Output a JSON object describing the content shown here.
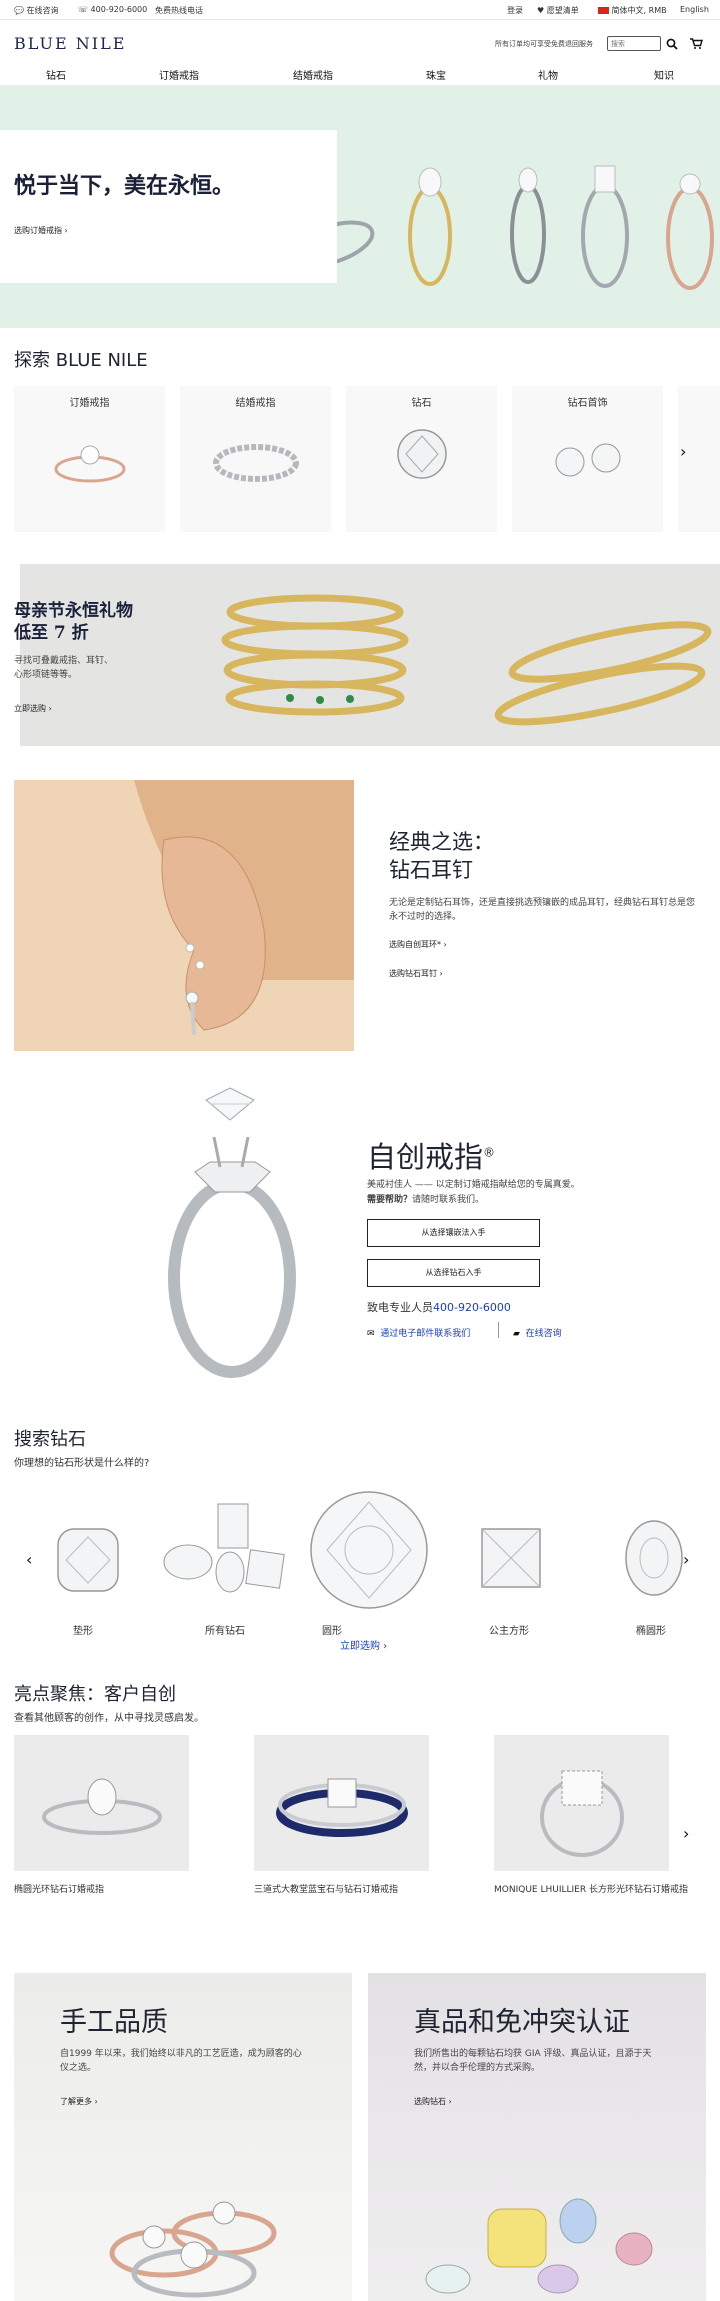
{
  "topbar": {
    "online_chat": "在线咨询",
    "phone": "400-920-6000",
    "free_hotline": "免费热线电话",
    "login": "登录",
    "wishlist": "愿望清单",
    "language": "简体中文, RMB",
    "english": "English"
  },
  "header": {
    "logo": "BLUE NILE",
    "free_return": "所有订单均可享受免费退回服务",
    "search_placeholder": "搜索"
  },
  "nav": {
    "items": [
      "钻石",
      "订婚戒指",
      "结婚戒指",
      "珠宝",
      "礼物",
      "知识"
    ]
  },
  "hero": {
    "title": "悦于当下，美在永恒。",
    "cta": "选购订婚戒指"
  },
  "explore": {
    "title": "探索 BLUE NILE",
    "categories": [
      "订婚戒指",
      "结婚戒指",
      "钻石",
      "钻石首饰"
    ]
  },
  "promo": {
    "title_line1": "母亲节永恒礼物",
    "title_line2": "低至 7 折",
    "desc_line1": "寻找可叠戴戒指、耳钉、",
    "desc_line2": "心形项链等等。",
    "cta": "立即选购"
  },
  "earrings": {
    "title_line1": "经典之选：",
    "title_line2": "钻石耳钉",
    "desc": "无论是定制钻石耳饰，还是直接挑选预镶嵌的成品耳钉，经典钻石耳钉总是您永不过时的选择。",
    "link1": "选购自创耳环*",
    "link2": "选购钻石耳钉"
  },
  "custom_ring": {
    "title": "自创戒指",
    "reg": "®",
    "desc": "美戒衬佳人 —— 以定制订婚戒指献给您的专属真爱。",
    "help_bold": "需要帮助？",
    "help_text": "请随时联系我们。",
    "btn1": "从选择镶嵌法入手",
    "btn2": "从选择钻石入手",
    "call_prefix": "致电专业人员",
    "phone": "400-920-6000",
    "email_link": "通过电子邮件联系我们",
    "chat_link": "在线咨询"
  },
  "search_diamonds": {
    "title": "搜索钻石",
    "subtitle": "你理想的钻石形状是什么样的?",
    "shapes": [
      "垫形",
      "所有钻石",
      "圆形",
      "公主方形",
      "椭圆形"
    ],
    "shop_now": "立即选购"
  },
  "spotlight": {
    "title": "亮点聚焦：客户自创",
    "subtitle": "查看其他顾客的创作，从中寻找灵感启发。",
    "items": [
      "椭圆光环钻石订婚戒指",
      "三道式大教堂蓝宝石与钻石订婚戒指",
      "MONIQUE LHUILLIER 长方形光环钻石订婚戒指"
    ]
  },
  "craft": {
    "title": "手工品质",
    "desc": "自1999 年以来，我们始终以非凡的工艺匠造，成为顾客的心仪之选。",
    "link": "了解更多"
  },
  "authentic": {
    "title": "真品和免冲突认证",
    "desc": "我们所售出的每颗钻石均获 GIA 评级、真品认证，且源于天然，并以合乎伦理的方式采购。",
    "link": "选购钻石"
  },
  "colors": {
    "navy": "#1b2450",
    "hero_bg": "#e2f1e8",
    "link_blue": "#1a3fb8",
    "gold": "#d7b65e"
  }
}
